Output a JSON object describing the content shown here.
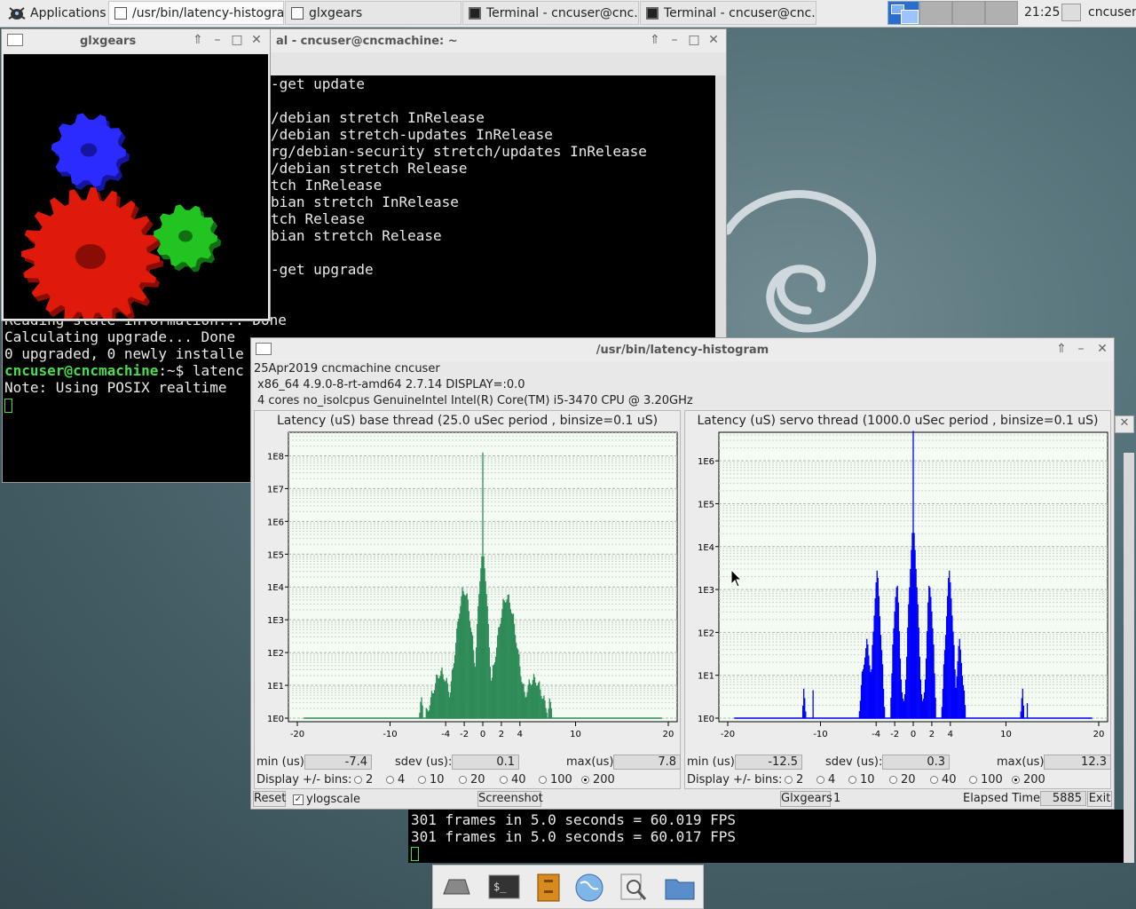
{
  "panel": {
    "applications_label": "Applications",
    "tasks": [
      "/usr/bin/latency-histogram",
      "glxgears",
      "Terminal - cncuser@cnc...",
      "Terminal - cncuser@cnc..."
    ],
    "clock": "21:25",
    "user": "cncuser"
  },
  "terminal_top": {
    "title": "al - cncuser@cncmachine: ~",
    "lines": [
      "-get update",
      "",
      "/debian stretch InRelease",
      "/debian stretch-updates InRelease",
      "rg/debian-security stretch/updates InRelease",
      "/debian stretch Release",
      "tch InRelease",
      "bian stretch InRelease",
      "tch Release",
      "bian stretch Release",
      "",
      "-get upgrade",
      "",
      "",
      "Reading state information... Done",
      "Calculating upgrade... Done",
      "0 upgraded, 0 newly installe"
    ],
    "prompt_user": "cncuser@cncmachine",
    "prompt_rest": ":~$ latenc",
    "note": "Note: Using POSIX realtime"
  },
  "glxgears": {
    "title": "glxgears"
  },
  "terminal_bottom": {
    "lines": [
      "301 frames in 5.0 seconds = 60.019 FPS",
      "301 frames in 5.0 seconds = 60.017 FPS"
    ]
  },
  "latency": {
    "title": "/usr/bin/latency-histogram",
    "info1": "25Apr2019 cncmachine cncuser",
    "info2": "x86_64  4.9.0-8-rt-amd64  2.7.14  DISPLAY=:0.0",
    "info3": "4 cores  no_isolcpus   GenuineIntel  Intel(R) Core(TM) i5-3470 CPU @ 3.20GHz",
    "labels": {
      "min": "min (us)",
      "sdev": "sdev (us):",
      "max": "max(us)",
      "bins": "Display +/- bins:"
    },
    "bin_options": [
      "2",
      "4",
      "10",
      "20",
      "40",
      "100",
      "200"
    ],
    "selected_bins": "200",
    "base": {
      "title": "Latency (uS) base thread (25.0 uSec period , binsize=0.1 uS)",
      "min": "-7.4",
      "sdev": "0.1",
      "max": "7.8",
      "xticks": [
        "-20",
        "-10",
        "-4",
        "-2",
        "0",
        "2",
        "4",
        "10",
        "20"
      ],
      "yticks": [
        "1E0",
        "1E1",
        "1E2",
        "1E3",
        "1E4",
        "1E5",
        "1E6",
        "1E7",
        "1E8"
      ],
      "color": "#2e8b57"
    },
    "servo": {
      "title": "Latency (uS) servo thread (1000.0 uSec period , binsize=0.1 uS)",
      "min": "-12.5",
      "sdev": "0.3",
      "max": "12.3",
      "xticks": [
        "-20",
        "-10",
        "-4",
        "-2",
        "0",
        "2",
        "4",
        "10",
        "20"
      ],
      "yticks": [
        "1E0",
        "1E1",
        "1E2",
        "1E3",
        "1E4",
        "1E5",
        "1E6"
      ],
      "color": "#0000ff"
    },
    "bottom": {
      "reset": "Reset",
      "ylogscale": "ylogscale",
      "screenshot": "Screenshot",
      "glxgears_btn": "Glxgears",
      "glxgears_count": "1",
      "elapsed_label": "Elapsed Time:",
      "elapsed": "5885",
      "exit": "Exit"
    }
  }
}
